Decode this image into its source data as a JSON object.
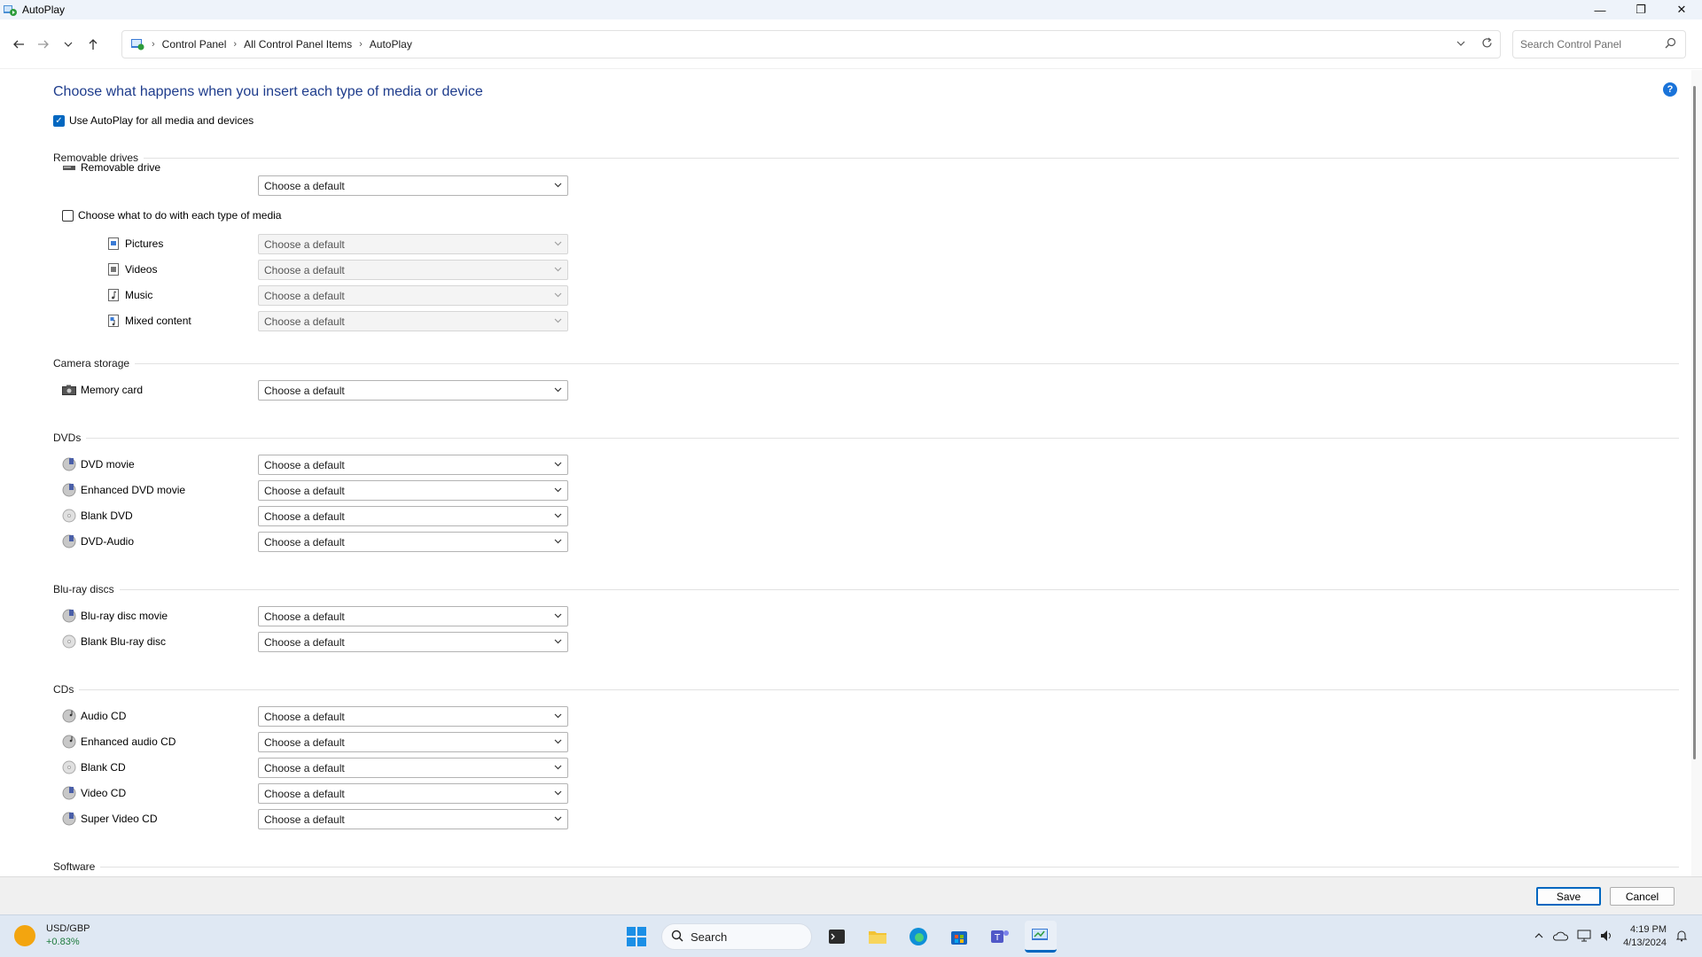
{
  "window": {
    "title": "AutoPlay",
    "minimize": "—",
    "maximize": "❐",
    "close": "✕"
  },
  "address": {
    "crumbs": [
      "Control Panel",
      "All Control Panel Items",
      "AutoPlay"
    ],
    "search_placeholder": "Search Control Panel"
  },
  "page": {
    "title": "Choose what happens when you insert each type of media or device",
    "use_autoplay_label": "Use AutoPlay for all media and devices",
    "use_autoplay_checked": true,
    "dropdown_default": "Choose a default"
  },
  "sections": {
    "removable": {
      "title": "Removable drives",
      "removable_drive": "Removable drive",
      "media_toggle_label": "Choose what to do with each type of media",
      "pictures": "Pictures",
      "videos": "Videos",
      "music": "Music",
      "mixed": "Mixed content"
    },
    "camera": {
      "title": "Camera storage",
      "memory_card": "Memory card"
    },
    "dvds": {
      "title": "DVDs",
      "dvd_movie": "DVD movie",
      "enhanced_dvd": "Enhanced DVD movie",
      "blank_dvd": "Blank DVD",
      "dvd_audio": "DVD-Audio"
    },
    "bluray": {
      "title": "Blu-ray discs",
      "movie": "Blu-ray disc movie",
      "blank": "Blank Blu-ray disc"
    },
    "cds": {
      "title": "CDs",
      "audio_cd": "Audio CD",
      "enhanced_audio_cd": "Enhanced audio CD",
      "blank_cd": "Blank CD",
      "video_cd": "Video CD",
      "super_video_cd": "Super Video CD"
    },
    "software": {
      "title": "Software"
    }
  },
  "actions": {
    "save": "Save",
    "cancel": "Cancel"
  },
  "taskbar": {
    "widget_title": "USD/GBP",
    "widget_value": "+0.83%",
    "search_label": "Search",
    "time": "4:19 PM",
    "date": "4/13/2024"
  },
  "colors": {
    "accent": "#0067c0",
    "title_blue": "#1e3c8c"
  }
}
